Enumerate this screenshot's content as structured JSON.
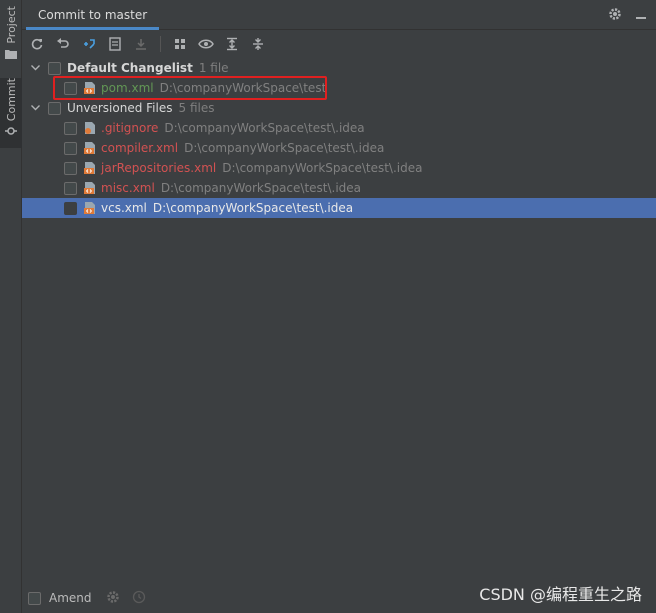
{
  "side": {
    "project_label": "Project",
    "commit_label": "Commit"
  },
  "header": {
    "title": "Commit to master"
  },
  "toolbar": {
    "icons": [
      "refresh-icon",
      "rollback-icon",
      "diff-icon",
      "show-diff-icon",
      "update-icon",
      "group-by-icon",
      "eye-icon",
      "expand-all-icon",
      "collapse-all-icon"
    ]
  },
  "tree": {
    "default_changelist": {
      "name": "Default Changelist",
      "count": "1 file",
      "files": [
        {
          "name": "pom.xml",
          "path": "D:\\companyWorkSpace\\test"
        }
      ]
    },
    "unversioned": {
      "name": "Unversioned Files",
      "count": "5 files",
      "files": [
        {
          "name": ".gitignore",
          "path": "D:\\companyWorkSpace\\test\\.idea"
        },
        {
          "name": "compiler.xml",
          "path": "D:\\companyWorkSpace\\test\\.idea"
        },
        {
          "name": "jarRepositories.xml",
          "path": "D:\\companyWorkSpace\\test\\.idea"
        },
        {
          "name": "misc.xml",
          "path": "D:\\companyWorkSpace\\test\\.idea"
        },
        {
          "name": "vcs.xml",
          "path": "D:\\companyWorkSpace\\test\\.idea"
        }
      ]
    }
  },
  "bottom": {
    "amend_label": "Amend"
  },
  "watermark": "CSDN @编程重生之路",
  "colors": {
    "accent": "#4a88c7",
    "selection": "#4b6eaf",
    "modified": "#629755",
    "unversioned": "#d25252",
    "highlight": "#e02020"
  }
}
